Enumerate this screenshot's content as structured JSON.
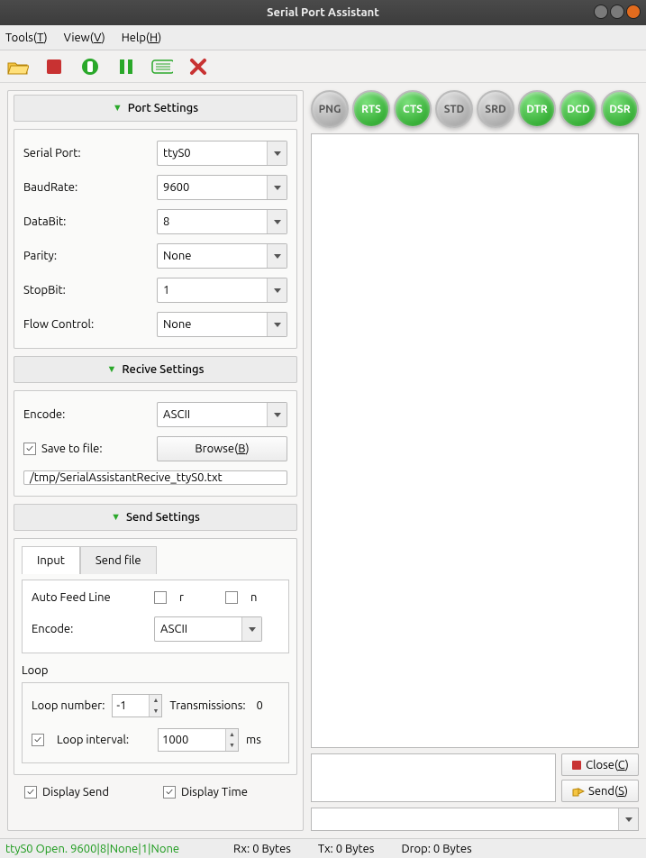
{
  "window": {
    "title": "Serial Port Assistant"
  },
  "menu": {
    "tools": "Tools(T)",
    "view": "View(V)",
    "help": "Help(H)"
  },
  "headers": {
    "port": "Port Settings",
    "recv": "Recive Settings",
    "send": "Send Settings"
  },
  "port": {
    "serial_lbl": "Serial Port:",
    "serial_val": "ttyS0",
    "baud_lbl": "BaudRate:",
    "baud_val": "9600",
    "data_lbl": "DataBit:",
    "data_val": "8",
    "parity_lbl": "Parity:",
    "parity_val": "None",
    "stop_lbl": "StopBit:",
    "stop_val": "1",
    "flow_lbl": "Flow Control:",
    "flow_val": "None"
  },
  "recv": {
    "encode_lbl": "Encode:",
    "encode_val": "ASCII",
    "save_lbl": "Save to file:",
    "browse_btn": "Browse(B)",
    "path": "/tmp/SerialAssistantRecive_ttyS0.txt"
  },
  "sendtab": {
    "tab_input": "Input",
    "tab_file": "Send file",
    "afl_lbl": "Auto Feed Line",
    "r_lbl": "r",
    "n_lbl": "n",
    "encode_lbl": "Encode:",
    "encode_val": "ASCII"
  },
  "loop": {
    "title": "Loop",
    "num_lbl": "Loop number:",
    "num_val": "-1",
    "trans_lbl": "Transmissions:",
    "trans_val": "0",
    "int_lbl": "Loop interval:",
    "int_val": "1000",
    "ms": "ms"
  },
  "display": {
    "send": "Display Send",
    "time": "Display Time"
  },
  "leds": [
    {
      "name": "PNG",
      "on": false
    },
    {
      "name": "RTS",
      "on": true
    },
    {
      "name": "CTS",
      "on": true
    },
    {
      "name": "STD",
      "on": false
    },
    {
      "name": "SRD",
      "on": false
    },
    {
      "name": "DTR",
      "on": true
    },
    {
      "name": "DCD",
      "on": true
    },
    {
      "name": "DSR",
      "on": true
    }
  ],
  "buttons": {
    "close": "Close(C)",
    "send": "Send(S)"
  },
  "status": {
    "conn": "ttyS0 Open. 9600|8|None|1|None",
    "rx": "Rx: 0 Bytes",
    "tx": "Tx: 0 Bytes",
    "drop": "Drop: 0 Bytes"
  }
}
